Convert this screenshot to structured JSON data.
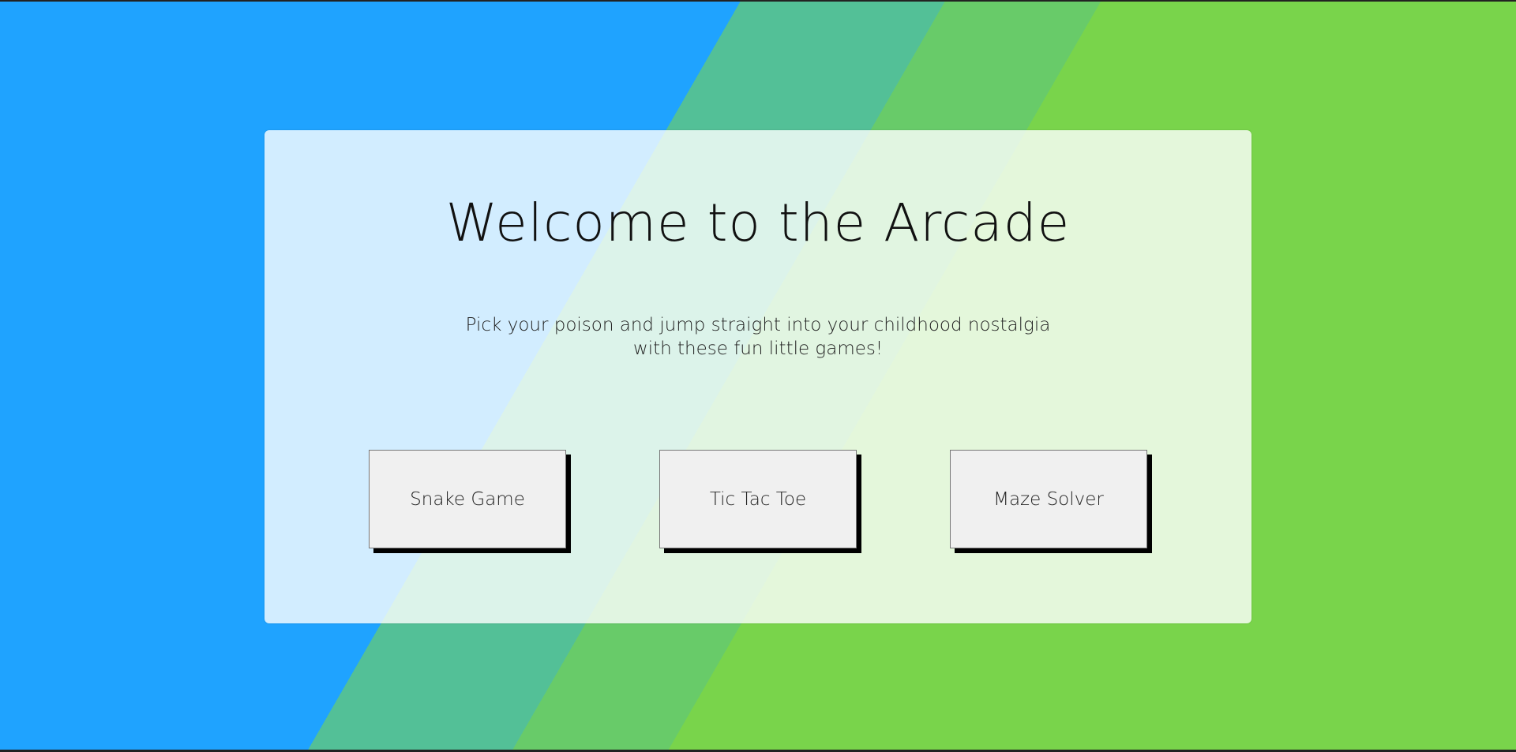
{
  "hero": {
    "title": "Welcome to the Arcade",
    "subtitle_line1": "Pick your poison and jump straight into your childhood nostalgia",
    "subtitle_line2": "with these fun little games!"
  },
  "games": [
    {
      "label": "Snake Game"
    },
    {
      "label": "Tic Tac Toe"
    },
    {
      "label": "Maze Solver"
    }
  ],
  "colors": {
    "background_blue": "#1fa3ff",
    "background_teal": "#53c097",
    "background_mid_green": "#68cb69",
    "background_green": "#79d44b",
    "button_fill": "#f0f0f0",
    "button_shadow": "#000000"
  }
}
